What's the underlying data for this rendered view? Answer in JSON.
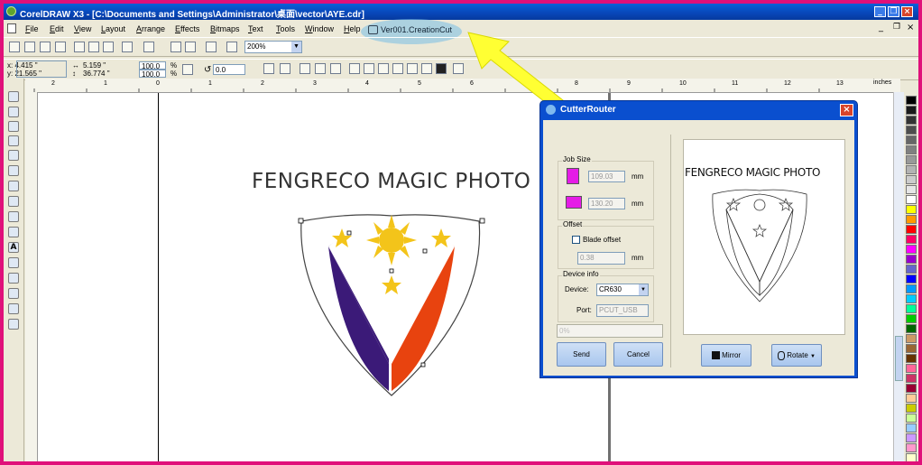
{
  "window": {
    "title": "CorelDRAW X3 - [C:\\Documents and Settings\\Administrator\\桌面\\vector\\AYE.cdr]"
  },
  "menu": [
    "File",
    "Edit",
    "View",
    "Layout",
    "Arrange",
    "Effects",
    "Bitmaps",
    "Text",
    "Tools",
    "Window",
    "Help"
  ],
  "highlight": {
    "label": "Ver001.CreationCut"
  },
  "toolbar": {
    "zoom": "200%"
  },
  "propbar": {
    "x": "x: 4.415 \"",
    "y": "y: 21.565 \"",
    "w": "5.159 \"",
    "h": "36.774 \"",
    "sx": "100.0",
    "sy": "100.0",
    "pct1": "%",
    "pct2": "%",
    "angle": "0.0"
  },
  "ruler": {
    "unit": "inches",
    "ticks": [
      "2",
      "1",
      "0",
      "1",
      "2",
      "3",
      "4",
      "5",
      "6",
      "7",
      "8",
      "9",
      "10",
      "11",
      "12",
      "13"
    ]
  },
  "canvas": {
    "text": "FENGRECO MAGIC PHOTO"
  },
  "dialog": {
    "title": "CutterRouter",
    "job_size": "Job Size",
    "height_value": "109.03",
    "width_value": "130.20",
    "unit": "mm",
    "offset": "Offset",
    "blade_offset_label": "Blade offset",
    "blade_offset_value": "0.38",
    "device_info": "Device info",
    "device_label": "Device:",
    "device_value": "CR630",
    "port_label": "Port:",
    "port_value": "PCUT_USB",
    "progress": "0%",
    "send": "Send",
    "cancel": "Cancel",
    "preview_text": "FENGRECO MAGIC PHOTO",
    "mirror": "Mirror",
    "rotate": "Rotate"
  },
  "colors": {
    "titlebar": "#0a4fcf",
    "frame": "#e0107a",
    "shield_left": "#3b1a78",
    "shield_right": "#e8430f",
    "sun": "#f3c41a"
  },
  "palette": [
    "#000000",
    "#1a1a1a",
    "#333333",
    "#4d4d4d",
    "#666666",
    "#808080",
    "#999999",
    "#b3b3b3",
    "#cccccc",
    "#e6e6e6",
    "#ffffff",
    "#ffff00",
    "#ff9900",
    "#ff0000",
    "#ff0066",
    "#ff00ff",
    "#9900cc",
    "#6666cc",
    "#0000ff",
    "#0099ff",
    "#00ccff",
    "#00ff99",
    "#00cc00",
    "#006600",
    "#cc9966",
    "#996633",
    "#663300",
    "#ff6699",
    "#cc3366",
    "#990033",
    "#ffcc99",
    "#cccc00",
    "#ccff99",
    "#99ccff",
    "#cc99ff",
    "#ff99cc",
    "#ffffcc"
  ]
}
